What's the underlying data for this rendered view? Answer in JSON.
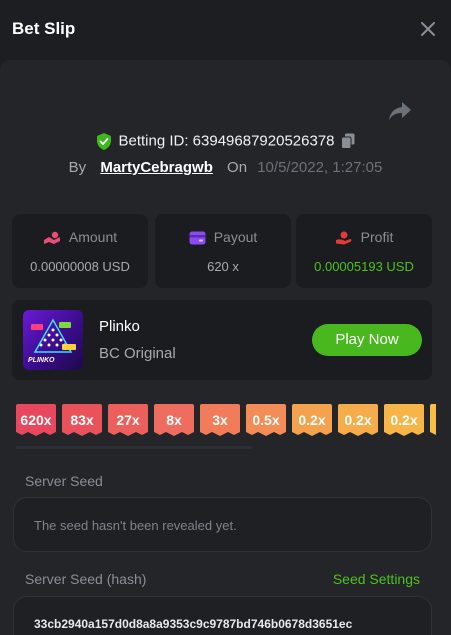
{
  "header": {
    "title": "Bet Slip",
    "close_icon": "close-icon"
  },
  "bet": {
    "id_label": "Betting ID: 63949687920526378",
    "by_label": "By",
    "user": "MartyCebragwb",
    "on_label": "On",
    "date": "10/5/2022, 1:27:05"
  },
  "stats": {
    "amount": {
      "label": "Amount",
      "value": "0.00000008 USD",
      "icon": "coins-icon"
    },
    "payout": {
      "label": "Payout",
      "value": "620 x",
      "icon": "wallet-icon"
    },
    "profit": {
      "label": "Profit",
      "value": "0.00005193 USD",
      "icon": "hand-money-icon"
    }
  },
  "game": {
    "name": "Plinko",
    "subtitle": "BC Original",
    "play_label": "Play Now",
    "thumb_label": "PLINKO"
  },
  "multipliers": [
    {
      "label": "620x",
      "color": "#e8485e"
    },
    {
      "label": "83x",
      "color": "#e9525b"
    },
    {
      "label": "27x",
      "color": "#ec5f5a"
    },
    {
      "label": "8x",
      "color": "#ef6d5e"
    },
    {
      "label": "3x",
      "color": "#f27b59"
    },
    {
      "label": "0.5x",
      "color": "#f48c57"
    },
    {
      "label": "0.2x",
      "color": "#f5a24f"
    },
    {
      "label": "0.2x",
      "color": "#f6ac4b"
    },
    {
      "label": "0.2x",
      "color": "#f7b548"
    },
    {
      "label": "",
      "color": "#f8bd45"
    }
  ],
  "seed": {
    "server_label": "Server Seed",
    "server_value": "The seed hasn't been revealed yet.",
    "hash_label": "Server Seed (hash)",
    "settings_label": "Seed Settings",
    "hash_value": "33cb2940a157d0d8a8a9353c9c9787bd746b0678d3651ec"
  },
  "colors": {
    "accent_green": "#4fc21a",
    "background": "#1c1e22",
    "panel": "#232529"
  }
}
